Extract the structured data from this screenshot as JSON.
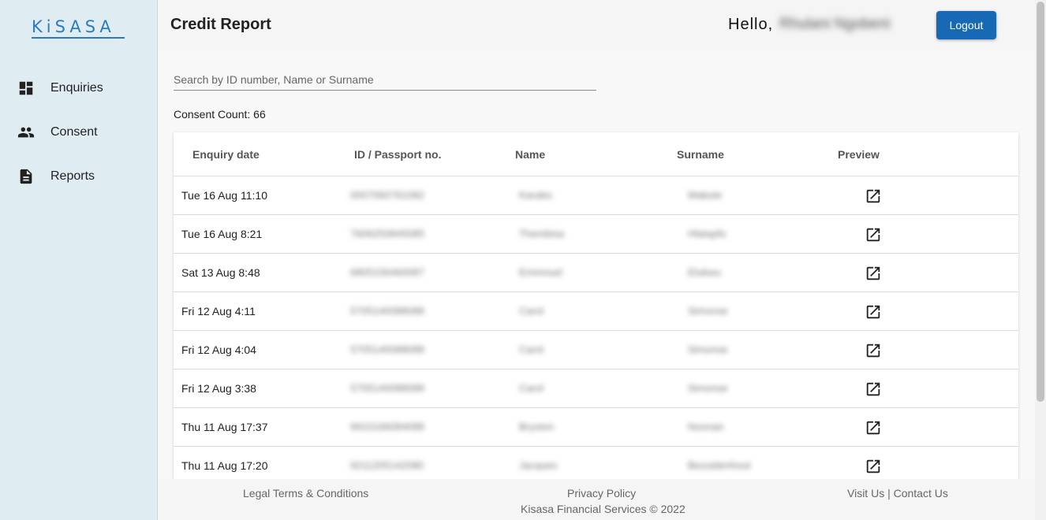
{
  "app": {
    "logo_text": "KiSASA",
    "page_title": "Credit Report",
    "greeting": "Hello,",
    "user_name": "Rhulani Ngobeni",
    "logout_label": "Logout"
  },
  "sidebar": {
    "items": [
      {
        "label": "Enquiries",
        "icon": "dashboard-icon"
      },
      {
        "label": "Consent",
        "icon": "people-icon"
      },
      {
        "label": "Reports",
        "icon": "document-icon"
      }
    ]
  },
  "search": {
    "placeholder": "Search by ID number, Name or Surname",
    "value": ""
  },
  "consent_count": "Consent Count: 66",
  "table": {
    "headers": [
      "Enquiry date",
      "ID / Passport no.",
      "Name",
      "Surname",
      "Preview"
    ],
    "rows": [
      {
        "date": "Tue 16 Aug 11:10",
        "id": "0007060761082",
        "name": "Karabo",
        "surname": "Mabote"
      },
      {
        "date": "Tue 16 Aug 8:21",
        "id": "7606250845085",
        "name": "Thembisa",
        "surname": "Hlatapfo"
      },
      {
        "date": "Sat 13 Aug 8:48",
        "id": "6805156460087",
        "name": "Emmnuel",
        "surname": "Elukwu"
      },
      {
        "date": "Fri 12 Aug 4:11",
        "id": "5705140088088",
        "name": "Carol",
        "surname": "Simonse"
      },
      {
        "date": "Fri 12 Aug 4:04",
        "id": "5705140088088",
        "name": "Carol",
        "surname": "Simonse"
      },
      {
        "date": "Fri 12 Aug 3:38",
        "id": "5705140088088",
        "name": "Carol",
        "surname": "Simonse"
      },
      {
        "date": "Thu 11 Aug 17:37",
        "id": "9910166084088",
        "name": "Bryston",
        "surname": "Noonan"
      },
      {
        "date": "Thu 11 Aug 17:20",
        "id": "9211205142080",
        "name": "Jacques",
        "surname": "Bezuidenhout"
      }
    ]
  },
  "footer": {
    "legal": "Legal Terms & Conditions",
    "privacy": "Privacy Policy",
    "visit_contact": "Visit Us | Contact Us",
    "copyright": "Kisasa Financial Services © 2022"
  },
  "colors": {
    "accent": "#1769b6",
    "sidebar_bg": "#dfedf3",
    "logo": "#2c7bbd"
  }
}
